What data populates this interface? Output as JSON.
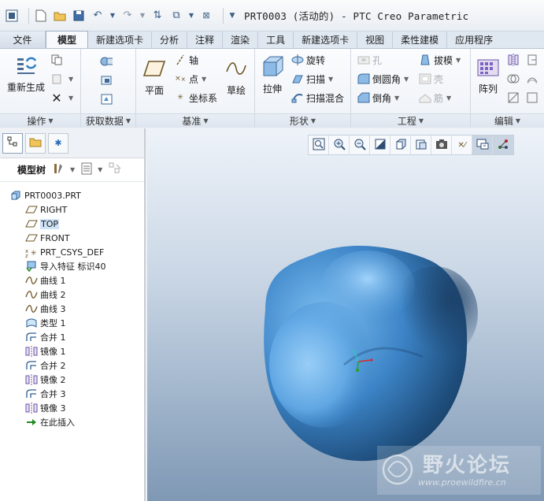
{
  "window": {
    "title": "PRT0003 (活动的) - PTC Creo Parametric"
  },
  "tabs": [
    "文件",
    "模型",
    "新建选项卡",
    "分析",
    "注释",
    "渲染",
    "工具",
    "新建选项卡",
    "视图",
    "柔性建模",
    "应用程序"
  ],
  "ribbon": {
    "groups": {
      "operations": "操作",
      "get_data": "获取数据",
      "datum": "基准",
      "shapes": "形状",
      "engineering": "工程",
      "edit": "编辑"
    },
    "buttons": {
      "regenerate": "重新生成",
      "plane": "平面",
      "axis": "轴",
      "point": "点",
      "csys": "坐标系",
      "sketch": "草绘",
      "extrude": "拉伸",
      "revolve": "旋转",
      "sweep": "扫描",
      "swept_blend": "扫描混合",
      "hole": "孔",
      "round": "倒圆角",
      "chamfer": "倒角",
      "draft": "拔模",
      "shell": "壳",
      "rib": "筋",
      "pattern": "阵列"
    }
  },
  "model_tree": {
    "label": "模型树",
    "items": [
      {
        "label": "PRT0003.PRT",
        "icon": "part-icon",
        "root": true
      },
      {
        "label": "RIGHT",
        "icon": "datum-plane-icon"
      },
      {
        "label": "TOP",
        "icon": "datum-plane-icon",
        "highlighted": true
      },
      {
        "label": "FRONT",
        "icon": "datum-plane-icon"
      },
      {
        "label": "PRT_CSYS_DEF",
        "icon": "csys-icon"
      },
      {
        "label": "导入特征 标识40",
        "icon": "import-feature-icon"
      },
      {
        "label": "曲线 1",
        "icon": "curve-icon"
      },
      {
        "label": "曲线 2",
        "icon": "curve-icon"
      },
      {
        "label": "曲线 3",
        "icon": "curve-icon"
      },
      {
        "label": "类型 1",
        "icon": "surface-icon"
      },
      {
        "label": "合并 1",
        "icon": "merge-icon"
      },
      {
        "label": "镜像 1",
        "icon": "mirror-icon"
      },
      {
        "label": "合并 2",
        "icon": "merge-icon"
      },
      {
        "label": "镜像 2",
        "icon": "mirror-icon"
      },
      {
        "label": "合并 3",
        "icon": "merge-icon"
      },
      {
        "label": "镜像 3",
        "icon": "mirror-icon"
      },
      {
        "label": "在此插入",
        "icon": "insert-here-arrow-icon"
      }
    ]
  },
  "watermark": {
    "brand": "野火论坛",
    "url": "www.proewildfire.cn"
  },
  "colors": {
    "accent": "#2d5f95",
    "tree_highlight": "#cfe3f7",
    "model_blue": "#3f7fbf"
  }
}
